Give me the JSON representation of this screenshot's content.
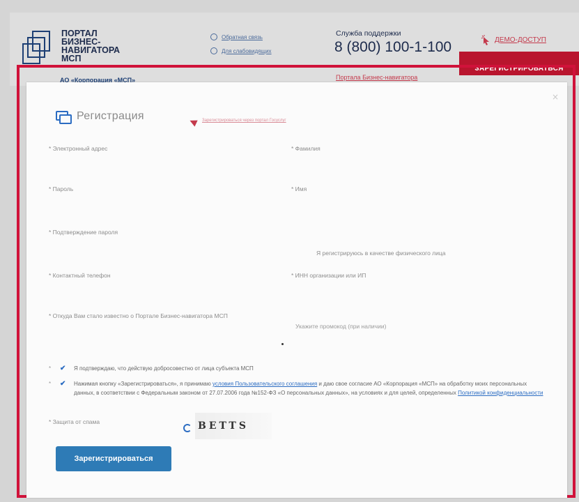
{
  "header": {
    "logo_text": "ПОРТАЛ\nБИЗНЕС-\nНАВИГАТОРА\nМСП",
    "corp_label": "АО «Корпорация «МСП»",
    "feedback_link": "Обратная связь",
    "visually_impaired_link": "Для слабовидящих",
    "support_label": "Служба поддержки",
    "support_phone": "8 (800) 100-1-100",
    "portal_link": "Портала Бизнес-навигатора",
    "demo_link": "ДЕМО-ДОСТУП",
    "register_button": "ЗАРЕГИСТРИРОВАТЬСЯ"
  },
  "modal": {
    "close_symbol": "×",
    "title": "Регистрация",
    "hint_link": "Зарегистрироваться через портал Госуслуг",
    "fields": {
      "email_label": "* Электронный адрес",
      "lastname_label": "* Фамилия",
      "password_label": "* Пароль",
      "firstname_label": "* Имя",
      "password_confirm_label": "* Подтверждение пароля",
      "individual_checkbox_label": "Я регистрируюсь в качестве физического лица",
      "phone_label": "* Контактный телефон",
      "inn_label": "* ИНН организации или ИП",
      "source_label": "* Откуда Вам стало известно о Портале Бизнес-навигатора МСП",
      "promo_placeholder": "Укажите промокод (при наличии)"
    },
    "legal": {
      "star": "*",
      "check": "✔",
      "consent_1": "Я подтверждаю, что действую добросовестно от лица субъекта МСП",
      "consent_2_prefix": "Нажимая кнопку «Зарегистрироваться», я принимаю ",
      "consent_2_link1": "условия Пользовательского соглашения",
      "consent_2_middle": " и даю свое согласие АО «Корпорация «МСП» на обработку моих персональных данных, в соответствии с Федеральным законом от 27.07.2006 года №152-ФЗ «О персональных данных», на условиях и для целей, определенных ",
      "consent_2_link2": "Политикой конфиденциальности"
    },
    "captcha_label": "* Защита от спама",
    "captcha_text": "BETTS",
    "submit_button": "Зарегистрироваться"
  },
  "colors": {
    "highlight_frame": "#d0123a",
    "accent_blue": "#2e7bb6",
    "brand_red": "#b9152e"
  }
}
